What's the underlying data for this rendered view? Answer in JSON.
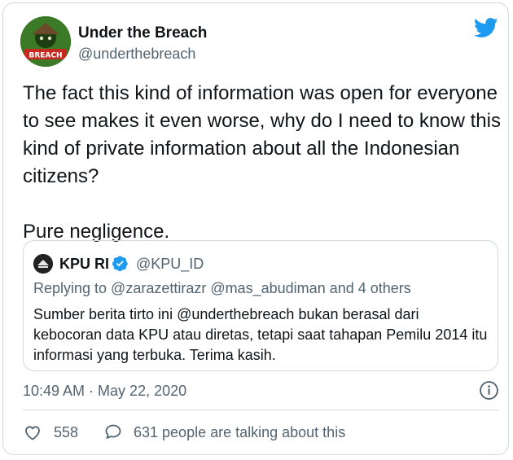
{
  "author": {
    "name": "Under the Breach",
    "handle": "@underthebreach",
    "avatar_text": "BREACH"
  },
  "tweet": {
    "text": "The fact this kind of information was open for everyone\nto see makes it even worse, why do I need to know this\nkind of private information about all the Indonesian\ncitizens?\n\nPure negligence."
  },
  "quote": {
    "name": "KPU RI",
    "handle": "@KPU_ID",
    "replying_to": "Replying to @zarazettirazr @mas_abudiman and 4 others",
    "text": "Sumber berita tirto ini @underthebreach bukan berasal dari kebocoran data KPU atau diretas, tetapi saat tahapan Pemilu 2014 itu informasi yang terbuka. Terima kasih."
  },
  "meta": {
    "timestamp": "10:49 AM · May 22, 2020"
  },
  "actions": {
    "like_count": "558",
    "talking": "631 people are talking about this"
  },
  "colors": {
    "twitter_blue": "#1d9bf0",
    "secondary_text": "#536471",
    "border": "#cfd9de"
  },
  "icons": [
    "twitter-bird-icon",
    "verified-badge-icon",
    "info-icon",
    "heart-icon",
    "reply-icon"
  ]
}
